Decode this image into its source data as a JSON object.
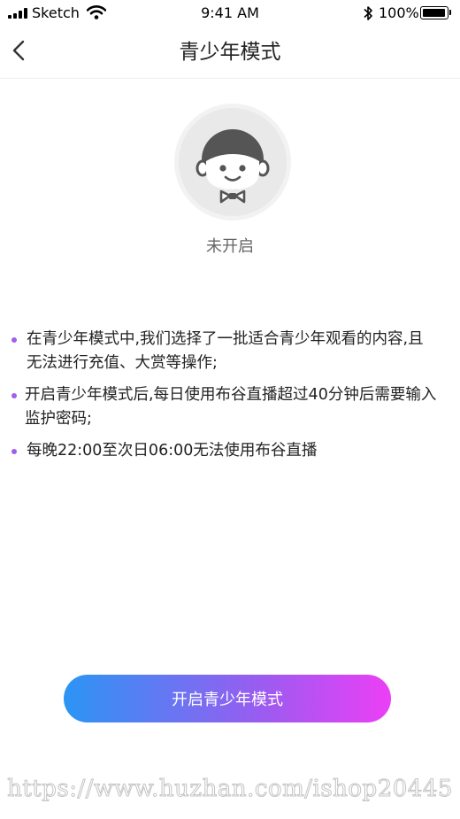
{
  "status_bar": {
    "carrier": "Sketch",
    "time": "9:41 AM",
    "battery_percent": "100%",
    "icons": [
      "signal-icon",
      "wifi-icon",
      "bluetooth-icon",
      "battery-icon"
    ],
    "battery_level": 1.0
  },
  "nav": {
    "title": "青少年模式",
    "back_icon": "chevron-left-icon"
  },
  "avatar": {
    "icon": "child-face-icon",
    "status": "未开启"
  },
  "notes": [
    "在青少年模式中,我们选择了一批适合青少年观看的内容,且无法进行充值、大赏等操作;",
    "开启青少年模式后,每日使用布谷直播超过40分钟后需要输入监护密码;",
    "每晚22:00至次日06:00无法使用布谷直播"
  ],
  "action": {
    "label": "开启青少年模式"
  },
  "watermark": "https://www.huzhan.com/ishop20445",
  "colors": {
    "bullet": "#a25ee8",
    "button_gradient_start": "#2b95f5",
    "button_gradient_end": "#ec3ff6"
  }
}
